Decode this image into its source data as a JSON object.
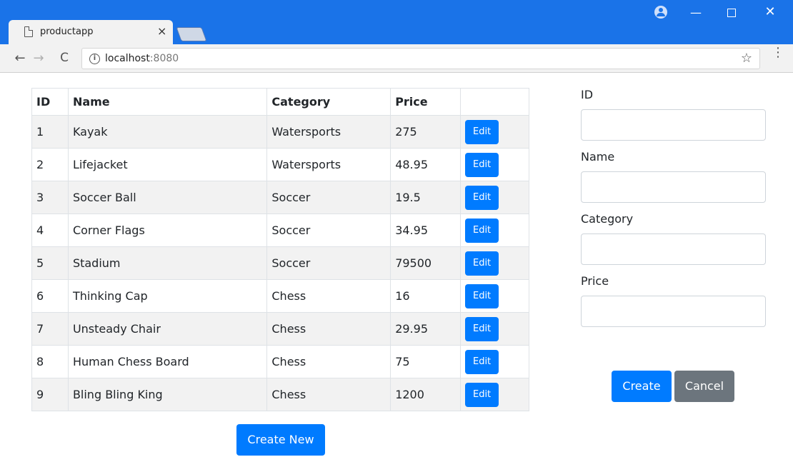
{
  "browser": {
    "tab_title": "productapp",
    "tab_close": "×",
    "url_host": "localhost",
    "url_port": ":8080",
    "info_symbol": "i",
    "star": "☆",
    "menu": "⋮",
    "back": "←",
    "forward": "→",
    "reload": "C",
    "minimize": "—",
    "close": "✕"
  },
  "table": {
    "headers": {
      "id": "ID",
      "name": "Name",
      "category": "Category",
      "price": "Price"
    },
    "rows": [
      {
        "id": "1",
        "name": "Kayak",
        "category": "Watersports",
        "price": "275",
        "action": "Edit"
      },
      {
        "id": "2",
        "name": "Lifejacket",
        "category": "Watersports",
        "price": "48.95",
        "action": "Edit"
      },
      {
        "id": "3",
        "name": "Soccer Ball",
        "category": "Soccer",
        "price": "19.5",
        "action": "Edit"
      },
      {
        "id": "4",
        "name": "Corner Flags",
        "category": "Soccer",
        "price": "34.95",
        "action": "Edit"
      },
      {
        "id": "5",
        "name": "Stadium",
        "category": "Soccer",
        "price": "79500",
        "action": "Edit"
      },
      {
        "id": "6",
        "name": "Thinking Cap",
        "category": "Chess",
        "price": "16",
        "action": "Edit"
      },
      {
        "id": "7",
        "name": "Unsteady Chair",
        "category": "Chess",
        "price": "29.95",
        "action": "Edit"
      },
      {
        "id": "8",
        "name": "Human Chess Board",
        "category": "Chess",
        "price": "75",
        "action": "Edit"
      },
      {
        "id": "9",
        "name": "Bling Bling King",
        "category": "Chess",
        "price": "1200",
        "action": "Edit"
      }
    ],
    "create_new": "Create New"
  },
  "form": {
    "fields": [
      {
        "label": "ID",
        "value": ""
      },
      {
        "label": "Name",
        "value": ""
      },
      {
        "label": "Category",
        "value": ""
      },
      {
        "label": "Price",
        "value": ""
      }
    ],
    "create": "Create",
    "cancel": "Cancel"
  },
  "colors": {
    "titlebar": "#1a73e8",
    "primary": "#007bff",
    "secondary": "#6c757d",
    "stripe": "#f2f2f2"
  }
}
